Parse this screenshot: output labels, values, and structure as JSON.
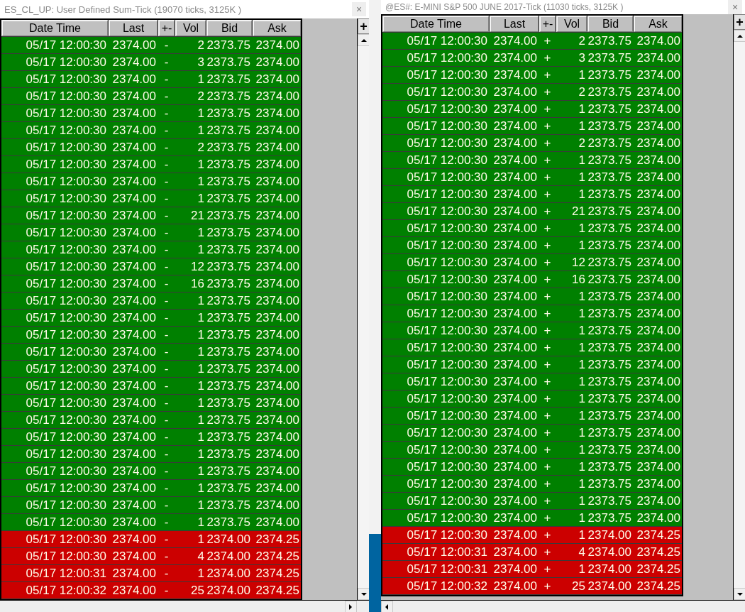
{
  "windows": [
    {
      "title": "ES_CL_UP: User Defined Sum-Tick (19070 ticks, 3125K )",
      "close": "×",
      "corner": "+",
      "columns": [
        "Date Time",
        "Last",
        "+-",
        "Vol",
        "Bid",
        "Ask"
      ],
      "rows": [
        {
          "time": "05/17 12:00:30",
          "last": "2374.00",
          "sign": "-",
          "vol": "2",
          "bid": "2373.75",
          "ask": "2374.00",
          "color": "#008000"
        },
        {
          "time": "05/17 12:00:30",
          "last": "2374.00",
          "sign": "-",
          "vol": "3",
          "bid": "2373.75",
          "ask": "2374.00",
          "color": "#008000"
        },
        {
          "time": "05/17 12:00:30",
          "last": "2374.00",
          "sign": "-",
          "vol": "1",
          "bid": "2373.75",
          "ask": "2374.00",
          "color": "#008000"
        },
        {
          "time": "05/17 12:00:30",
          "last": "2374.00",
          "sign": "-",
          "vol": "2",
          "bid": "2373.75",
          "ask": "2374.00",
          "color": "#008000"
        },
        {
          "time": "05/17 12:00:30",
          "last": "2374.00",
          "sign": "-",
          "vol": "1",
          "bid": "2373.75",
          "ask": "2374.00",
          "color": "#008000"
        },
        {
          "time": "05/17 12:00:30",
          "last": "2374.00",
          "sign": "-",
          "vol": "1",
          "bid": "2373.75",
          "ask": "2374.00",
          "color": "#008000"
        },
        {
          "time": "05/17 12:00:30",
          "last": "2374.00",
          "sign": "-",
          "vol": "2",
          "bid": "2373.75",
          "ask": "2374.00",
          "color": "#008000"
        },
        {
          "time": "05/17 12:00:30",
          "last": "2374.00",
          "sign": "-",
          "vol": "1",
          "bid": "2373.75",
          "ask": "2374.00",
          "color": "#008000"
        },
        {
          "time": "05/17 12:00:30",
          "last": "2374.00",
          "sign": "-",
          "vol": "1",
          "bid": "2373.75",
          "ask": "2374.00",
          "color": "#008000"
        },
        {
          "time": "05/17 12:00:30",
          "last": "2374.00",
          "sign": "-",
          "vol": "1",
          "bid": "2373.75",
          "ask": "2374.00",
          "color": "#008000"
        },
        {
          "time": "05/17 12:00:30",
          "last": "2374.00",
          "sign": "-",
          "vol": "21",
          "bid": "2373.75",
          "ask": "2374.00",
          "color": "#008000"
        },
        {
          "time": "05/17 12:00:30",
          "last": "2374.00",
          "sign": "-",
          "vol": "1",
          "bid": "2373.75",
          "ask": "2374.00",
          "color": "#008000"
        },
        {
          "time": "05/17 12:00:30",
          "last": "2374.00",
          "sign": "-",
          "vol": "1",
          "bid": "2373.75",
          "ask": "2374.00",
          "color": "#008000"
        },
        {
          "time": "05/17 12:00:30",
          "last": "2374.00",
          "sign": "-",
          "vol": "12",
          "bid": "2373.75",
          "ask": "2374.00",
          "color": "#008000"
        },
        {
          "time": "05/17 12:00:30",
          "last": "2374.00",
          "sign": "-",
          "vol": "16",
          "bid": "2373.75",
          "ask": "2374.00",
          "color": "#008000"
        },
        {
          "time": "05/17 12:00:30",
          "last": "2374.00",
          "sign": "-",
          "vol": "1",
          "bid": "2373.75",
          "ask": "2374.00",
          "color": "#008000"
        },
        {
          "time": "05/17 12:00:30",
          "last": "2374.00",
          "sign": "-",
          "vol": "1",
          "bid": "2373.75",
          "ask": "2374.00",
          "color": "#008000"
        },
        {
          "time": "05/17 12:00:30",
          "last": "2374.00",
          "sign": "-",
          "vol": "1",
          "bid": "2373.75",
          "ask": "2374.00",
          "color": "#008000"
        },
        {
          "time": "05/17 12:00:30",
          "last": "2374.00",
          "sign": "-",
          "vol": "1",
          "bid": "2373.75",
          "ask": "2374.00",
          "color": "#008000"
        },
        {
          "time": "05/17 12:00:30",
          "last": "2374.00",
          "sign": "-",
          "vol": "1",
          "bid": "2373.75",
          "ask": "2374.00",
          "color": "#008000"
        },
        {
          "time": "05/17 12:00:30",
          "last": "2374.00",
          "sign": "-",
          "vol": "1",
          "bid": "2373.75",
          "ask": "2374.00",
          "color": "#008000"
        },
        {
          "time": "05/17 12:00:30",
          "last": "2374.00",
          "sign": "-",
          "vol": "1",
          "bid": "2373.75",
          "ask": "2374.00",
          "color": "#008000"
        },
        {
          "time": "05/17 12:00:30",
          "last": "2374.00",
          "sign": "-",
          "vol": "1",
          "bid": "2373.75",
          "ask": "2374.00",
          "color": "#008000"
        },
        {
          "time": "05/17 12:00:30",
          "last": "2374.00",
          "sign": "-",
          "vol": "1",
          "bid": "2373.75",
          "ask": "2374.00",
          "color": "#008000"
        },
        {
          "time": "05/17 12:00:30",
          "last": "2374.00",
          "sign": "-",
          "vol": "1",
          "bid": "2373.75",
          "ask": "2374.00",
          "color": "#008000"
        },
        {
          "time": "05/17 12:00:30",
          "last": "2374.00",
          "sign": "-",
          "vol": "1",
          "bid": "2373.75",
          "ask": "2374.00",
          "color": "#008000"
        },
        {
          "time": "05/17 12:00:30",
          "last": "2374.00",
          "sign": "-",
          "vol": "1",
          "bid": "2373.75",
          "ask": "2374.00",
          "color": "#008000"
        },
        {
          "time": "05/17 12:00:30",
          "last": "2374.00",
          "sign": "-",
          "vol": "1",
          "bid": "2373.75",
          "ask": "2374.00",
          "color": "#008000"
        },
        {
          "time": "05/17 12:00:30",
          "last": "2374.00",
          "sign": "-",
          "vol": "1",
          "bid": "2373.75",
          "ask": "2374.00",
          "color": "#008000"
        },
        {
          "time": "05/17 12:00:30",
          "last": "2374.00",
          "sign": "-",
          "vol": "1",
          "bid": "2374.00",
          "ask": "2374.25",
          "color": "#cc0000"
        },
        {
          "time": "05/17 12:00:30",
          "last": "2374.00",
          "sign": "-",
          "vol": "4",
          "bid": "2374.00",
          "ask": "2374.25",
          "color": "#cc0000"
        },
        {
          "time": "05/17 12:00:31",
          "last": "2374.00",
          "sign": "-",
          "vol": "1",
          "bid": "2374.00",
          "ask": "2374.25",
          "color": "#cc0000"
        },
        {
          "time": "05/17 12:00:32",
          "last": "2374.00",
          "sign": "-",
          "vol": "25",
          "bid": "2374.00",
          "ask": "2374.25",
          "color": "#cc0000"
        }
      ]
    },
    {
      "title": "@ES#: E-MINI S&P 500 JUNE 2017-Tick (11030 ticks, 3125K )",
      "close": "×",
      "corner": "+",
      "columns": [
        "Date Time",
        "Last",
        "+-",
        "Vol",
        "Bid",
        "Ask"
      ],
      "rows": [
        {
          "time": "05/17 12:00:30",
          "last": "2374.00",
          "sign": "+",
          "vol": "2",
          "bid": "2373.75",
          "ask": "2374.00",
          "color": "#008000"
        },
        {
          "time": "05/17 12:00:30",
          "last": "2374.00",
          "sign": "+",
          "vol": "3",
          "bid": "2373.75",
          "ask": "2374.00",
          "color": "#008000"
        },
        {
          "time": "05/17 12:00:30",
          "last": "2374.00",
          "sign": "+",
          "vol": "1",
          "bid": "2373.75",
          "ask": "2374.00",
          "color": "#008000"
        },
        {
          "time": "05/17 12:00:30",
          "last": "2374.00",
          "sign": "+",
          "vol": "2",
          "bid": "2373.75",
          "ask": "2374.00",
          "color": "#008000"
        },
        {
          "time": "05/17 12:00:30",
          "last": "2374.00",
          "sign": "+",
          "vol": "1",
          "bid": "2373.75",
          "ask": "2374.00",
          "color": "#008000"
        },
        {
          "time": "05/17 12:00:30",
          "last": "2374.00",
          "sign": "+",
          "vol": "1",
          "bid": "2373.75",
          "ask": "2374.00",
          "color": "#008000"
        },
        {
          "time": "05/17 12:00:30",
          "last": "2374.00",
          "sign": "+",
          "vol": "2",
          "bid": "2373.75",
          "ask": "2374.00",
          "color": "#008000"
        },
        {
          "time": "05/17 12:00:30",
          "last": "2374.00",
          "sign": "+",
          "vol": "1",
          "bid": "2373.75",
          "ask": "2374.00",
          "color": "#008000"
        },
        {
          "time": "05/17 12:00:30",
          "last": "2374.00",
          "sign": "+",
          "vol": "1",
          "bid": "2373.75",
          "ask": "2374.00",
          "color": "#008000"
        },
        {
          "time": "05/17 12:00:30",
          "last": "2374.00",
          "sign": "+",
          "vol": "1",
          "bid": "2373.75",
          "ask": "2374.00",
          "color": "#008000"
        },
        {
          "time": "05/17 12:00:30",
          "last": "2374.00",
          "sign": "+",
          "vol": "21",
          "bid": "2373.75",
          "ask": "2374.00",
          "color": "#008000"
        },
        {
          "time": "05/17 12:00:30",
          "last": "2374.00",
          "sign": "+",
          "vol": "1",
          "bid": "2373.75",
          "ask": "2374.00",
          "color": "#008000"
        },
        {
          "time": "05/17 12:00:30",
          "last": "2374.00",
          "sign": "+",
          "vol": "1",
          "bid": "2373.75",
          "ask": "2374.00",
          "color": "#008000"
        },
        {
          "time": "05/17 12:00:30",
          "last": "2374.00",
          "sign": "+",
          "vol": "12",
          "bid": "2373.75",
          "ask": "2374.00",
          "color": "#008000"
        },
        {
          "time": "05/17 12:00:30",
          "last": "2374.00",
          "sign": "+",
          "vol": "16",
          "bid": "2373.75",
          "ask": "2374.00",
          "color": "#008000"
        },
        {
          "time": "05/17 12:00:30",
          "last": "2374.00",
          "sign": "+",
          "vol": "1",
          "bid": "2373.75",
          "ask": "2374.00",
          "color": "#008000"
        },
        {
          "time": "05/17 12:00:30",
          "last": "2374.00",
          "sign": "+",
          "vol": "1",
          "bid": "2373.75",
          "ask": "2374.00",
          "color": "#008000"
        },
        {
          "time": "05/17 12:00:30",
          "last": "2374.00",
          "sign": "+",
          "vol": "1",
          "bid": "2373.75",
          "ask": "2374.00",
          "color": "#008000"
        },
        {
          "time": "05/17 12:00:30",
          "last": "2374.00",
          "sign": "+",
          "vol": "1",
          "bid": "2373.75",
          "ask": "2374.00",
          "color": "#008000"
        },
        {
          "time": "05/17 12:00:30",
          "last": "2374.00",
          "sign": "+",
          "vol": "1",
          "bid": "2373.75",
          "ask": "2374.00",
          "color": "#008000"
        },
        {
          "time": "05/17 12:00:30",
          "last": "2374.00",
          "sign": "+",
          "vol": "1",
          "bid": "2373.75",
          "ask": "2374.00",
          "color": "#008000"
        },
        {
          "time": "05/17 12:00:30",
          "last": "2374.00",
          "sign": "+",
          "vol": "1",
          "bid": "2373.75",
          "ask": "2374.00",
          "color": "#008000"
        },
        {
          "time": "05/17 12:00:30",
          "last": "2374.00",
          "sign": "+",
          "vol": "1",
          "bid": "2373.75",
          "ask": "2374.00",
          "color": "#008000"
        },
        {
          "time": "05/17 12:00:30",
          "last": "2374.00",
          "sign": "+",
          "vol": "1",
          "bid": "2373.75",
          "ask": "2374.00",
          "color": "#008000"
        },
        {
          "time": "05/17 12:00:30",
          "last": "2374.00",
          "sign": "+",
          "vol": "1",
          "bid": "2373.75",
          "ask": "2374.00",
          "color": "#008000"
        },
        {
          "time": "05/17 12:00:30",
          "last": "2374.00",
          "sign": "+",
          "vol": "1",
          "bid": "2373.75",
          "ask": "2374.00",
          "color": "#008000"
        },
        {
          "time": "05/17 12:00:30",
          "last": "2374.00",
          "sign": "+",
          "vol": "1",
          "bid": "2373.75",
          "ask": "2374.00",
          "color": "#008000"
        },
        {
          "time": "05/17 12:00:30",
          "last": "2374.00",
          "sign": "+",
          "vol": "1",
          "bid": "2373.75",
          "ask": "2374.00",
          "color": "#008000"
        },
        {
          "time": "05/17 12:00:30",
          "last": "2374.00",
          "sign": "+",
          "vol": "1",
          "bid": "2373.75",
          "ask": "2374.00",
          "color": "#008000"
        },
        {
          "time": "05/17 12:00:30",
          "last": "2374.00",
          "sign": "+",
          "vol": "1",
          "bid": "2374.00",
          "ask": "2374.25",
          "color": "#cc0000"
        },
        {
          "time": "05/17 12:00:31",
          "last": "2374.00",
          "sign": "+",
          "vol": "4",
          "bid": "2374.00",
          "ask": "2374.25",
          "color": "#cc0000"
        },
        {
          "time": "05/17 12:00:31",
          "last": "2374.00",
          "sign": "+",
          "vol": "1",
          "bid": "2374.00",
          "ask": "2374.25",
          "color": "#cc0000"
        },
        {
          "time": "05/17 12:00:32",
          "last": "2374.00",
          "sign": "+",
          "vol": "25",
          "bid": "2374.00",
          "ask": "2374.25",
          "color": "#cc0000"
        }
      ]
    }
  ]
}
